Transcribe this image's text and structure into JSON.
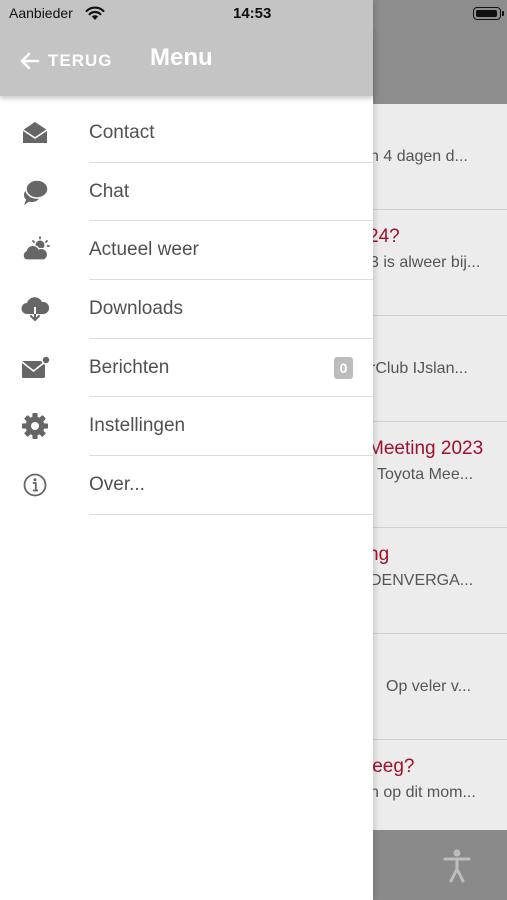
{
  "status_bar": {
    "carrier": "Aanbieder",
    "time": "14:53"
  },
  "drawer": {
    "back_label": "TERUG",
    "title": "Menu",
    "items": [
      {
        "label": "Contact",
        "icon": "envelope-open-icon"
      },
      {
        "label": "Chat",
        "icon": "chat-bubbles-icon"
      },
      {
        "label": "Actueel weer",
        "icon": "weather-cloud-sun-icon"
      },
      {
        "label": "Downloads",
        "icon": "cloud-download-icon"
      },
      {
        "label": "Berichten",
        "icon": "mail-notification-icon",
        "badge": "0"
      },
      {
        "label": "Instellingen",
        "icon": "gear-icon"
      },
      {
        "label": "Over...",
        "icon": "info-icon"
      }
    ]
  },
  "background": {
    "rows": [
      {
        "title": "",
        "subtitle": "n 4 dagen d..."
      },
      {
        "title": "24?",
        "subtitle": "3 is alweer bij..."
      },
      {
        "title": "",
        "subtitle": "rClub IJslan..."
      },
      {
        "title": "Meeting 2023",
        "subtitle": "Toyota Mee..."
      },
      {
        "title": "ng",
        "subtitle": "DENVERGA..."
      },
      {
        "title": "",
        "subtitle": "Op veler v..."
      },
      {
        "title": "leeg?",
        "subtitle": "n op dit mom..."
      }
    ]
  },
  "colors": {
    "accent": "#a0102a",
    "header_gray": "#c4c4c4",
    "icon_gray": "#666666"
  }
}
